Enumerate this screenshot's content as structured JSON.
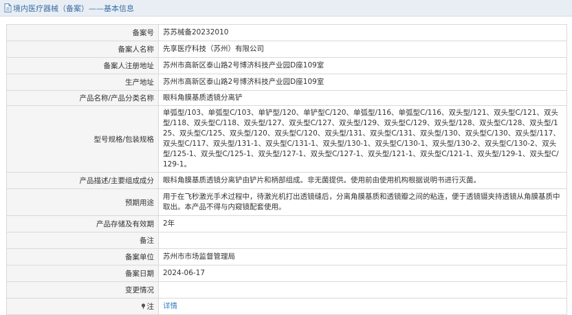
{
  "header": {
    "title": "境内医疗器械（备案）——基本信息"
  },
  "rows": [
    {
      "label": "备案号",
      "value": "苏苏械备20232010"
    },
    {
      "label": "备案人名称",
      "value": "先享医疗科技（苏州）有限公司"
    },
    {
      "label": "备案人注册地址",
      "value": "苏州市高新区泰山路2号博济科技产业园D座109室"
    },
    {
      "label": "生产地址",
      "value": "苏州市高新区泰山路2号博济科技产业园D座109室"
    },
    {
      "label": "产品名称/产品分类名称",
      "value": "眼科角膜基质透镜分离铲"
    },
    {
      "label": "型号规格/包装规格",
      "value": "单弧型/103、单弧型C/103、单铲型/120、单铲型C/120、单弧型/116、单弧型C/116、双头型/121、双头型C/121、双头型/118、双头型C/118、双头型/127、双头型C/127、双头型/129、双头型C/129、双头型/128、双头型C/128、双头型/125、双头型C/125、双头型/120、双头型C/120、双头型/131、双头型C/131、双头型/130、双头型C/130、双头型/117、双头型C/117、双头型/131-1、双头型C/131-1、双头型/130-1、双头型C/130-1、双头型/130-2、双头型C/130-2、双头型/125-1、双头型C/125-1、双头型/127-1、双头型C/127-1、双头型/121-1、双头型C/121-1、双头型/129-1、双头型C/129-1。"
    },
    {
      "label": "产品描述/主要组成成分",
      "value": "眼科角膜基质透镜分离铲由铲片和柄部组成。非无菌提供。使用前由使用机构根据说明书进行灭菌。"
    },
    {
      "label": "预期用途",
      "value": "用于在飞秒激光手术过程中，待激光机打出透镜缝后，分离角膜基质和透镜瓣之间的粘连，便于透镜镊夹持透镜从角膜基质中取出。本产品不得与内窥镜配套使用。"
    },
    {
      "label": "产品存储及有效期",
      "value": "2年"
    },
    {
      "label": "备注",
      "value": ""
    },
    {
      "label": "备案单位",
      "value": "苏州市市场监督管理局"
    },
    {
      "label": "备案日期",
      "value": "2024-06-17"
    },
    {
      "label": "变更情况",
      "value": ""
    },
    {
      "label": "注",
      "value": "详情"
    }
  ]
}
